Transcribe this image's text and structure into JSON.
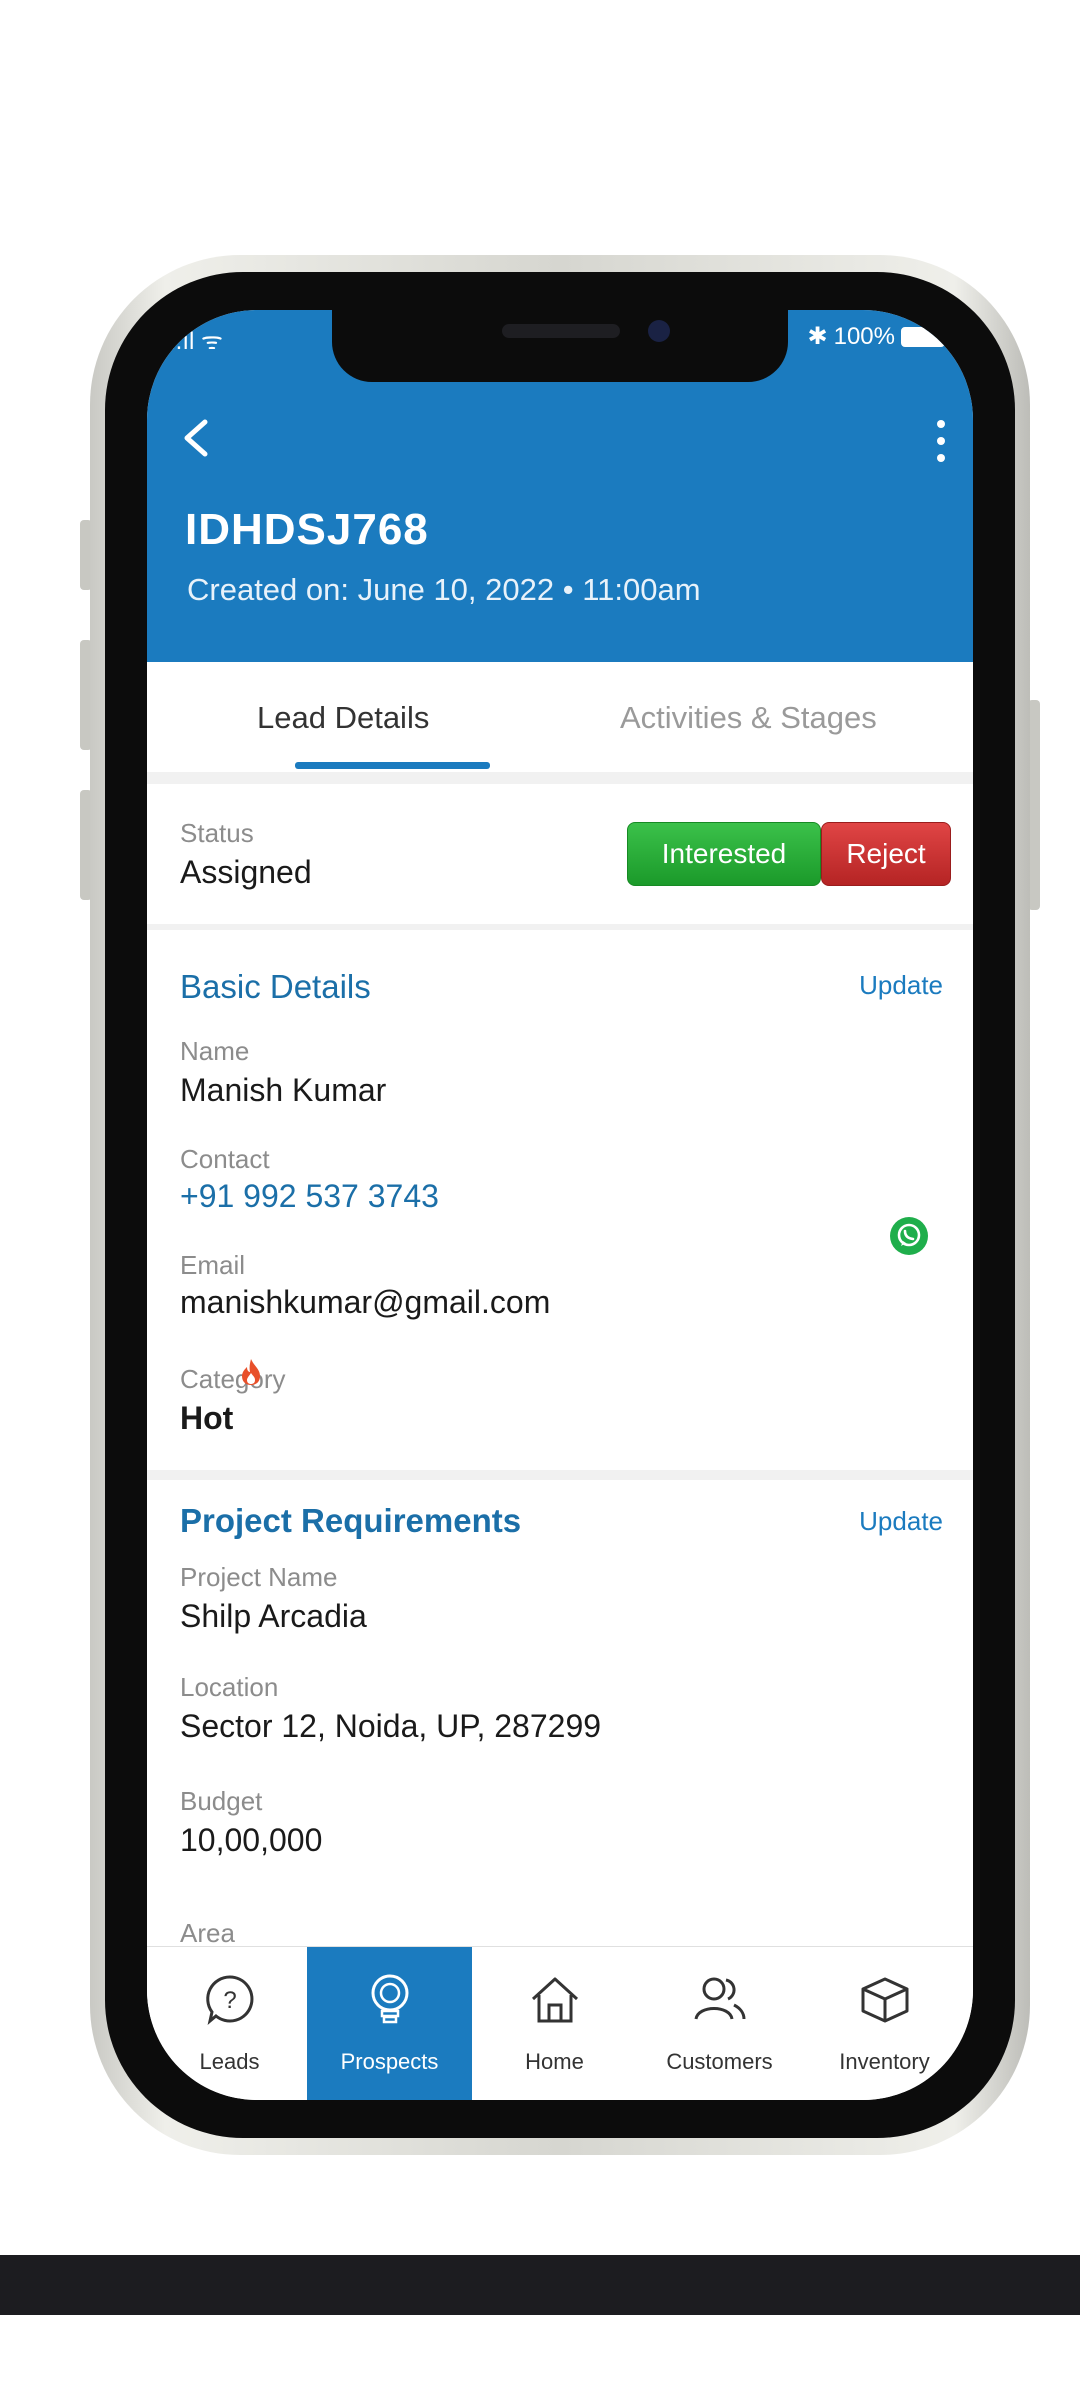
{
  "statusbar": {
    "left": "..ıl ᯤ",
    "battery": "100%"
  },
  "header": {
    "lead_id": "IDHDSJ768",
    "created": "Created on: June 10, 2022  •  11:00am"
  },
  "tabs": [
    {
      "label": "Lead Details",
      "active": true
    },
    {
      "label": "Activities & Stages",
      "active": false
    }
  ],
  "status": {
    "label": "Status",
    "value": "Assigned",
    "interested_button": "Interested",
    "reject_button": "Reject"
  },
  "basic": {
    "title": "Basic Details",
    "update": "Update",
    "name_label": "Name",
    "name_value": "Manish Kumar",
    "contact_label": "Contact",
    "contact_value": "+91 992 537 3743",
    "email_label": "Email",
    "email_value": "manishkumar@gmail.com",
    "category_label": "Category",
    "category_value": "Hot"
  },
  "project": {
    "title": "Project Requirements",
    "update": "Update",
    "project_label": "Project Name",
    "project_value": "Shilp Arcadia",
    "location_label": "Location",
    "location_value": "Sector 12, Noida, UP, 287299",
    "budget_label": "Budget",
    "budget_value": "10,00,000",
    "area_label": "Area"
  },
  "nav": [
    {
      "label": "Leads",
      "icon": "question-icon",
      "active": false
    },
    {
      "label": "Prospects",
      "icon": "bulb-icon",
      "active": true
    },
    {
      "label": "Home",
      "icon": "home-icon",
      "active": false
    },
    {
      "label": "Customers",
      "icon": "customers-icon",
      "active": false
    },
    {
      "label": "Inventory",
      "icon": "box-icon",
      "active": false
    }
  ],
  "colors": {
    "brand": "#1b7bbf",
    "interested": "#1b9a2a",
    "reject": "#b52424",
    "whatsapp": "#1fae4b",
    "fire": "#e8502a"
  }
}
